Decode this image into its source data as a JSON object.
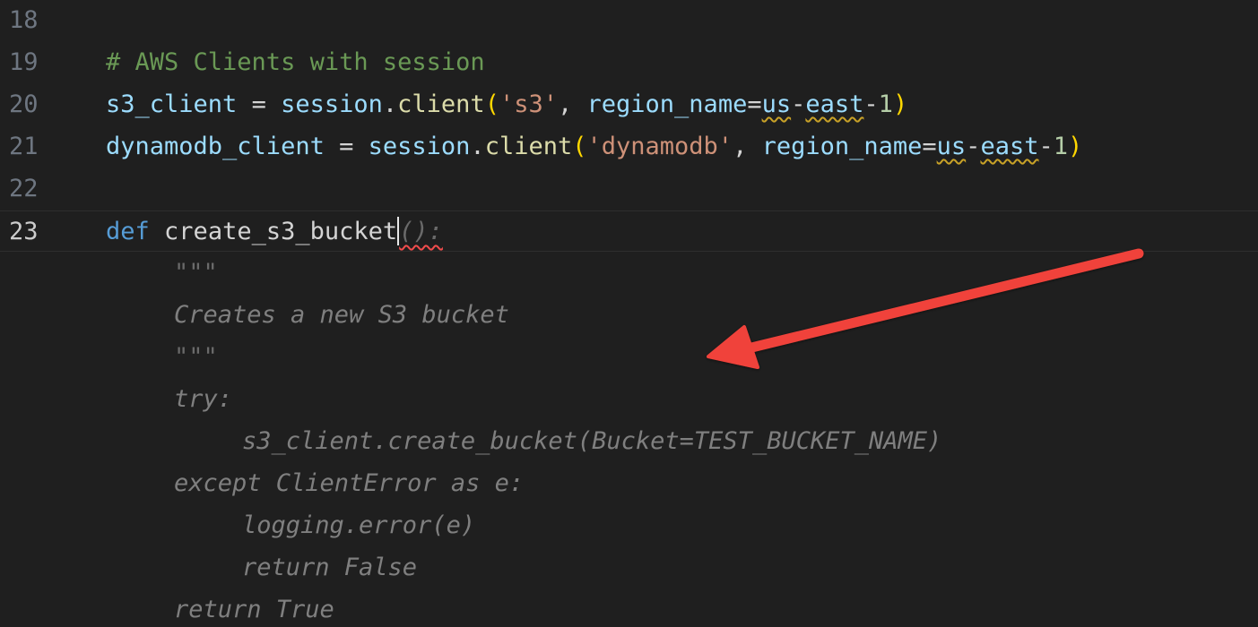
{
  "editor": {
    "lines": [
      {
        "number": "18",
        "text": ""
      },
      {
        "number": "19",
        "comment": "# AWS Clients with session"
      },
      {
        "number": "20",
        "var": "s3_client",
        "eq": " = ",
        "obj": "session",
        "dot": ".",
        "call": "client",
        "open": "(",
        "arg": "'s3'",
        "comma": ", ",
        "kwarg": "region_name",
        "assign": "=",
        "v1": "us",
        "d1": "-",
        "v2": "east",
        "d2": "-",
        "v3": "1",
        "close": ")"
      },
      {
        "number": "21",
        "var": "dynamodb_client",
        "eq": " = ",
        "obj": "session",
        "dot": ".",
        "call": "client",
        "open": "(",
        "arg": "'dynamodb'",
        "comma": ", ",
        "kwarg": "region_name",
        "assign": "=",
        "v1": "us",
        "d1": "-",
        "v2": "east",
        "d2": "-",
        "v3": "1",
        "close": ")"
      },
      {
        "number": "22",
        "text": ""
      },
      {
        "number": "23",
        "kw": "def",
        "sp": " ",
        "fname": "create_s3_bucket",
        "ghost": "():"
      },
      {
        "ghost": "\"\"\""
      },
      {
        "ghost": "Creates a new S3 bucket"
      },
      {
        "ghost": "\"\"\""
      },
      {
        "ghost": "try:"
      },
      {
        "ghost": "s3_client.create_bucket(Bucket=TEST_BUCKET_NAME)"
      },
      {
        "ghost": "except ClientError as e:"
      },
      {
        "ghost": "logging.error(e)"
      },
      {
        "ghost": "return False"
      },
      {
        "ghost": "return True"
      }
    ]
  },
  "colors": {
    "background": "#1f1f1f",
    "annotation_arrow": "#f0433a"
  },
  "icons": {
    "annotation": "arrow-annotation-icon"
  }
}
